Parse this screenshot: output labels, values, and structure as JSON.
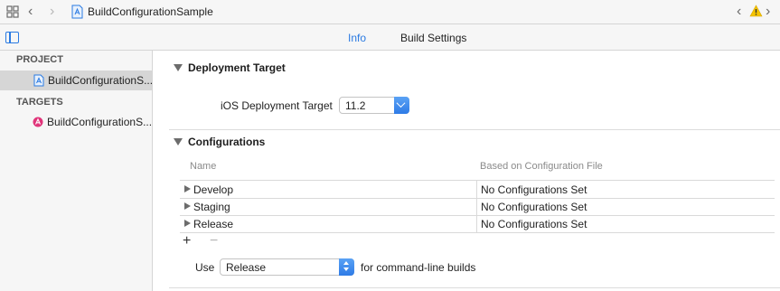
{
  "jumpbar": {
    "project_name": "BuildConfigurationSample"
  },
  "tabs": [
    {
      "label": "Info",
      "active": true
    },
    {
      "label": "Build Settings",
      "active": false
    }
  ],
  "sidebar": {
    "project_header": "PROJECT",
    "project_item": "BuildConfigurationS...",
    "targets_header": "TARGETS",
    "target_item": "BuildConfigurationS..."
  },
  "deployment": {
    "title": "Deployment Target",
    "label": "iOS Deployment Target",
    "value": "11.2"
  },
  "configurations": {
    "title": "Configurations",
    "columns": [
      "Name",
      "Based on Configuration File"
    ],
    "rows": [
      {
        "name": "Develop",
        "file": "No Configurations Set"
      },
      {
        "name": "Staging",
        "file": "No Configurations Set"
      },
      {
        "name": "Release",
        "file": "No Configurations Set"
      }
    ],
    "add_symbol": "+",
    "remove_symbol": "−",
    "use_label": "Use",
    "use_value": "Release",
    "use_suffix": "for command-line builds"
  },
  "colors": {
    "accent": "#2a7ae2",
    "warning": "#f5c400",
    "target_icon": "#e0357a"
  },
  "icons": {
    "grid": "grid-icon",
    "back": "chevron-left-icon",
    "forward": "chevron-right-icon",
    "file": "project-file-icon",
    "warning": "warning-icon",
    "sidebar": "sidebar-toggle-icon",
    "target": "app-target-icon"
  }
}
